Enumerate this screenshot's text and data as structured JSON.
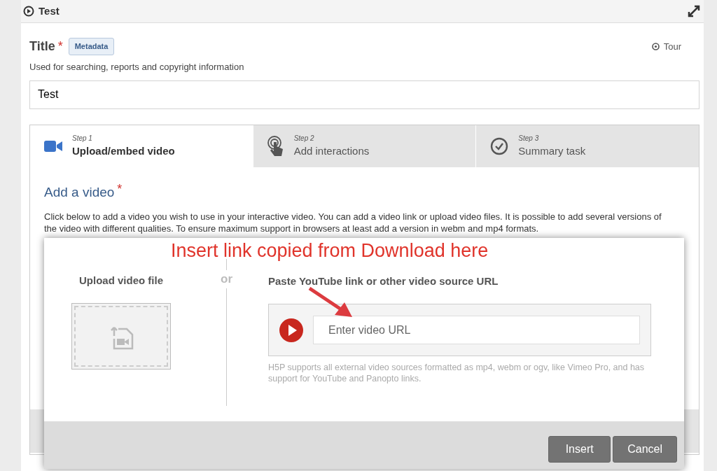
{
  "header": {
    "title": "Test"
  },
  "title_field": {
    "label": "Title",
    "required_mark": "*",
    "badge": "Metadata",
    "description": "Used for searching, reports and copyright information",
    "value": "Test",
    "tour": "Tour"
  },
  "tabs": [
    {
      "step": "Step 1",
      "label": "Upload/embed video",
      "kind": "camera",
      "selected": true
    },
    {
      "step": "Step 2",
      "label": "Add interactions",
      "kind": "tap",
      "selected": false
    },
    {
      "step": "Step 3",
      "label": "Summary task",
      "kind": "check",
      "selected": false
    }
  ],
  "section": {
    "heading": "Add a video",
    "required_mark": "*",
    "description": "Click below to add a video you wish to use in your interactive video. You can add a video link or upload video files. It is possible to add several versions of the video with different qualities. To ensure maximum support in browsers at least add a version in webm and mp4 formats."
  },
  "dialog": {
    "upload_heading": "Upload video file",
    "or": "or",
    "url_heading": "Paste YouTube link or other video source URL",
    "url_placeholder": "Enter video URL",
    "help": "H5P supports all external video sources formatted as mp4, webm or ogv, like Vimeo Pro, and has support for YouTube and Panopto links.",
    "buttons": [
      "Insert",
      "Cancel"
    ]
  },
  "annotation": {
    "text": "Insert link copied from Download here"
  }
}
